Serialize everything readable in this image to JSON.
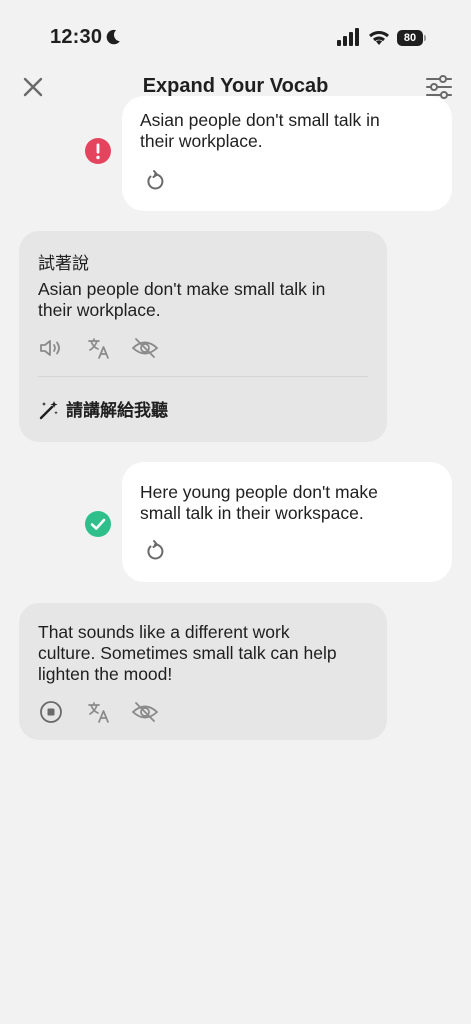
{
  "status_bar": {
    "time": "12:30",
    "battery": "80",
    "icons": [
      "moon-icon",
      "signal-icon",
      "wifi-icon",
      "battery-icon"
    ]
  },
  "header": {
    "title": "Expand Your Vocab",
    "close_icon": "close-icon",
    "settings_icon": "sliders-icon"
  },
  "messages": {
    "user1": {
      "text": "Asian people don't small talk in\ntheir workplace.",
      "status": "error",
      "status_color": "#e5445f"
    },
    "suggestion": {
      "label": "試著說",
      "text": "Asian people don't make small talk in\ntheir workplace.",
      "explain_label": "請講解給我聽"
    },
    "user2": {
      "text": "Here young people don't make\nsmall talk in their workspace.",
      "status": "correct",
      "status_color": "#2fbf8a"
    },
    "ai_reply": {
      "text": "That sounds like a different work\nculture. Sometimes small talk can help\nlighten the mood!"
    }
  },
  "colors": {
    "background": "#f2f2f2",
    "user_bubble": "#ffffff",
    "ai_bubble": "#e6e6e6",
    "icon_gray": "#8a8a8a"
  }
}
